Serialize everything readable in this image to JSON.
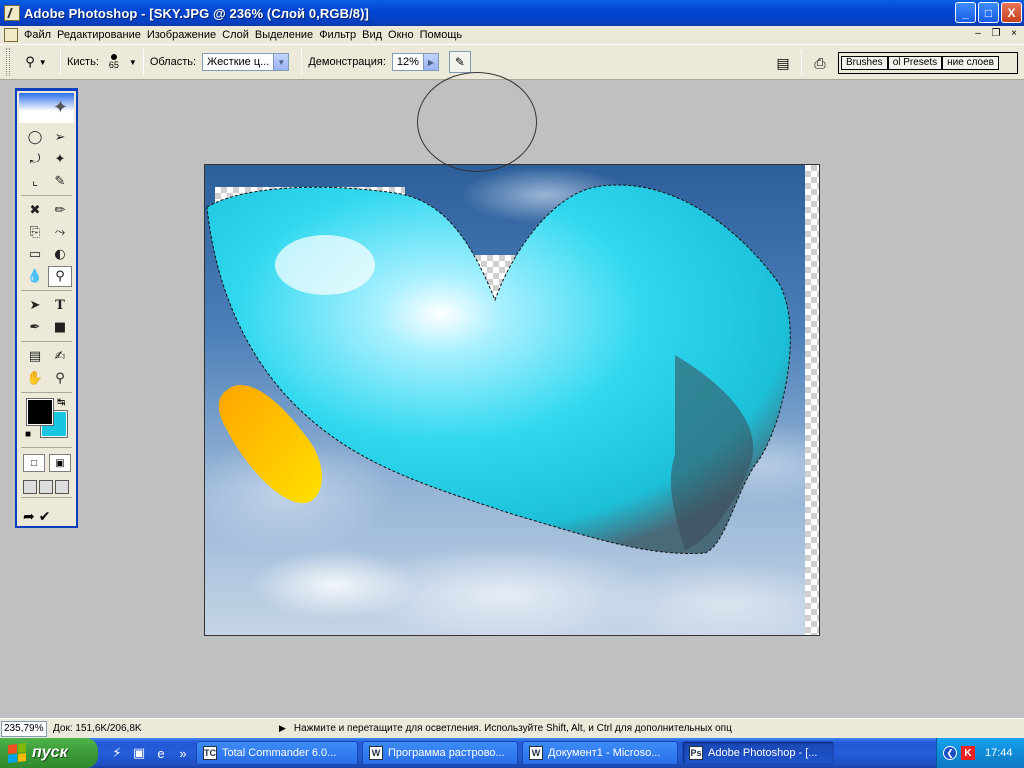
{
  "window": {
    "title": "Adobe Photoshop - [SKY.JPG @ 236% (Слой 0,RGB/8)]",
    "buttons": {
      "minimize": "_",
      "maximize": "□",
      "close": "X"
    }
  },
  "menu": {
    "items": [
      "Файл",
      "Редактирование",
      "Изображение",
      "Слой",
      "Выделение",
      "Фильтр",
      "Вид",
      "Окно",
      "Помощь"
    ],
    "doc_buttons": {
      "minimize": "–",
      "restore": "❐",
      "close": "×"
    }
  },
  "options": {
    "brush_label": "Кисть:",
    "brush_size": "65",
    "range_label": "Область:",
    "range_value": "Жесткие ц...",
    "exposure_label": "Демонстрация:",
    "exposure_value": "12%",
    "palette_tabs": [
      "Brushes",
      "ol Presets",
      "ние слоев"
    ]
  },
  "toolbox": {
    "fg_color": "#000000",
    "bg_color": "#19c6e0"
  },
  "status": {
    "zoom": "235,79%",
    "doc_size": "Док: 151,6K/206,8K",
    "hint": "Нажмите и перетащите для осветления. Используйте Shift, Alt, и Ctrl для дополнительных опц"
  },
  "taskbar": {
    "start_label": "пуск",
    "tasks": [
      {
        "label": "Total Commander 6.0...",
        "icon": "TC"
      },
      {
        "label": "Программа растрово...",
        "icon": "W"
      },
      {
        "label": "Документ1 - Microso...",
        "icon": "W"
      },
      {
        "label": "Adobe Photoshop - [...",
        "icon": "Ps"
      }
    ],
    "clock": "17:44"
  },
  "canvas": {
    "heart_color": "#1ee0f0",
    "stroke_color_top": "#ffa500",
    "stroke_color_bottom": "#ffe000"
  }
}
